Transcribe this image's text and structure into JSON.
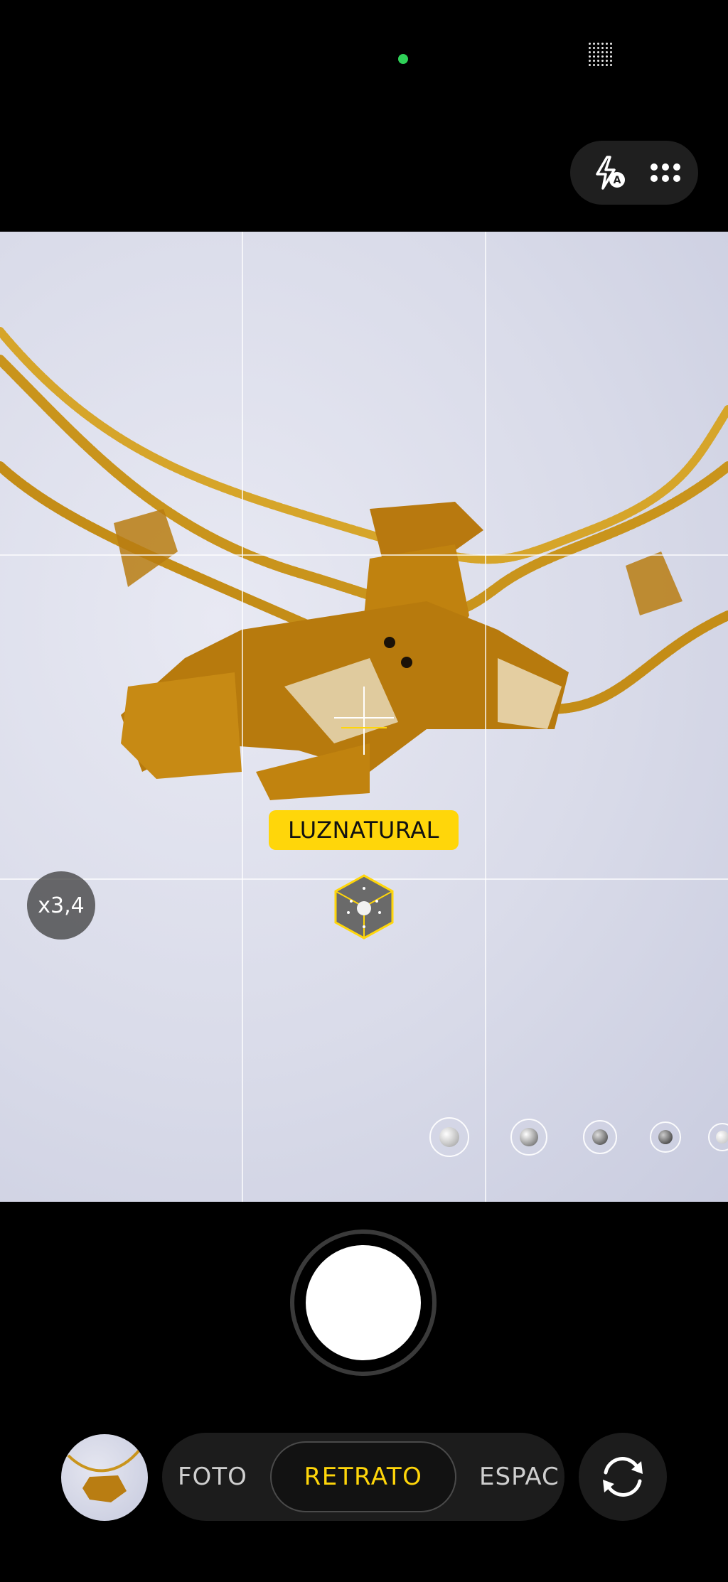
{
  "camera": {
    "zoom_label": "x3,4",
    "light_label_part1": "LUZ ",
    "light_label_part2": "NATURAL",
    "accent_color": "#ffd60a",
    "modes": [
      {
        "label": "FOTO"
      },
      {
        "label": "RETRATO",
        "selected": true
      },
      {
        "label": "ESPAC"
      }
    ],
    "icons": {
      "flash": "flash-auto-icon",
      "more": "more-dots-icon",
      "grid": "grid-dots-icon",
      "switch": "switch-camera-icon"
    }
  }
}
